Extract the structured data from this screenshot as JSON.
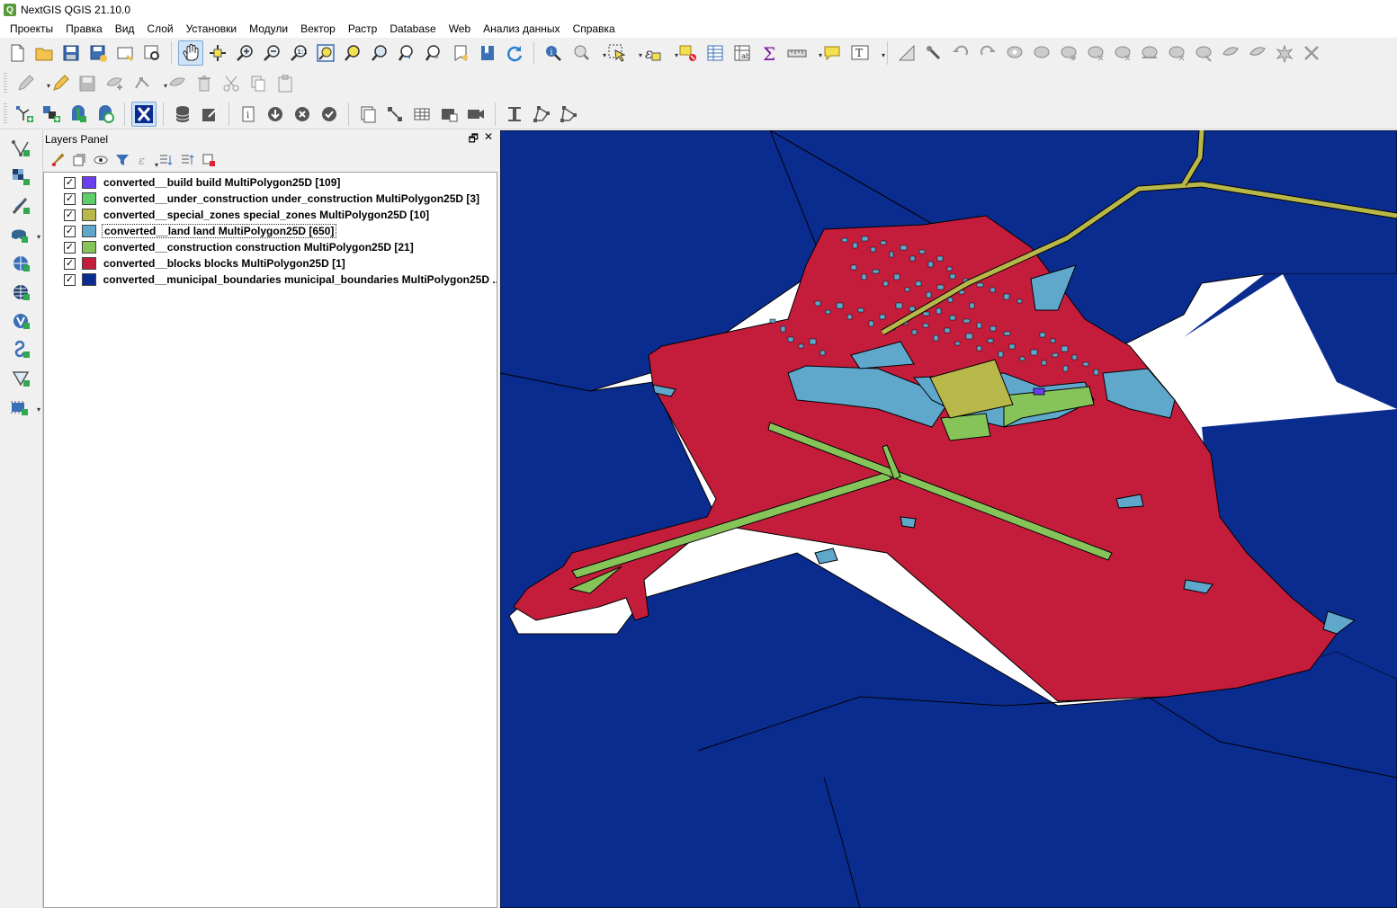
{
  "window": {
    "title": "NextGIS QGIS 21.10.0"
  },
  "menu": [
    "Проекты",
    "Правка",
    "Вид",
    "Слой",
    "Установки",
    "Модули",
    "Вектор",
    "Растр",
    "Database",
    "Web",
    "Анализ данных",
    "Справка"
  ],
  "layers_panel": {
    "title": "Layers Panel",
    "layers": [
      {
        "name": "converted__build build MultiPolygon25D [109]",
        "color": "#6a3ff2",
        "checked": true,
        "selected": false
      },
      {
        "name": "converted__under_construction under_construction MultiPolygon25D [3]",
        "color": "#5ccf6b",
        "checked": true,
        "selected": false
      },
      {
        "name": "converted__special_zones special_zones MultiPolygon25D [10]",
        "color": "#b8b84a",
        "checked": true,
        "selected": false
      },
      {
        "name": "converted__land land MultiPolygon25D [650]",
        "color": "#5fa8cc",
        "checked": true,
        "selected": true
      },
      {
        "name": "converted__construction construction MultiPolygon25D [21]",
        "color": "#86c45a",
        "checked": true,
        "selected": false
      },
      {
        "name": "converted__blocks blocks MultiPolygon25D [1]",
        "color": "#c41d3c",
        "checked": true,
        "selected": false
      },
      {
        "name": "converted__municipal_boundaries municipal_boundaries MultiPolygon25D ...",
        "color": "#0b2c8f",
        "checked": true,
        "selected": false
      }
    ]
  },
  "map": {
    "colors": {
      "municipal": "#0b2c8f",
      "blocks": "#c41d3c",
      "land": "#5fa8cc",
      "special": "#b8b84a",
      "construction": "#86c45a",
      "build": "#6a3ff2",
      "background": "#ffffff"
    }
  },
  "icons": {
    "row1": [
      "new-project-icon",
      "open-project-icon",
      "save-project-icon",
      "save-as-icon",
      "print-layout-icon",
      "layout-manager-icon",
      "pan-icon",
      "pan-to-selection-icon",
      "zoom-in-icon",
      "zoom-out-icon",
      "zoom-native-icon",
      "zoom-full-icon",
      "zoom-to-selection-icon",
      "zoom-to-layer-icon",
      "zoom-last-icon",
      "zoom-next-icon",
      "new-bookmark-icon",
      "show-bookmarks-icon",
      "refresh-icon",
      "identify-icon",
      "map-tips-icon",
      "select-features-icon",
      "select-by-expression-icon",
      "deselect-icon",
      "attribute-table-icon",
      "field-calculator-icon",
      "statistics-icon",
      "measure-icon",
      "annotation-icon",
      "text-annotation-icon",
      "digitize-icon",
      "snapping-icon",
      "undo-icon",
      "redo-icon",
      "add-ring-icon",
      "add-part-icon",
      "fill-ring-icon",
      "delete-ring-icon",
      "delete-part-icon",
      "reshape-icon",
      "offset-curve-icon",
      "split-features-icon",
      "split-parts-icon",
      "merge-features-icon"
    ],
    "row2": [
      "current-edits-icon",
      "toggle-editing-icon",
      "save-edits-icon",
      "add-polygon-icon",
      "vertex-tool-icon",
      "move-feature-icon",
      "delete-selected-icon",
      "cut-features-icon",
      "copy-features-icon",
      "paste-features-icon"
    ],
    "row3": [
      "new-geopackage-icon",
      "new-shapefile-icon",
      "new-temp-layer-icon",
      "new-spatialite-icon",
      "ngw-connect-icon",
      "db-manager-icon",
      "ngw-edit-icon",
      "info-icon",
      "download-icon",
      "cancel-icon",
      "check-icon",
      "copy-layer-icon",
      "georef-icon",
      "table-icon",
      "image-icon",
      "video-icon",
      "vertex-edit-icon",
      "transform-icon",
      "pen-icon"
    ],
    "left": [
      "add-vector-layer-icon",
      "add-raster-layer-icon",
      "add-delimited-text-icon",
      "add-postgis-icon",
      "add-wms-icon",
      "add-wfs-icon",
      "add-virtual-layer-icon",
      "add-spatialite-icon",
      "add-mesh-icon",
      "add-gpx-icon"
    ]
  }
}
